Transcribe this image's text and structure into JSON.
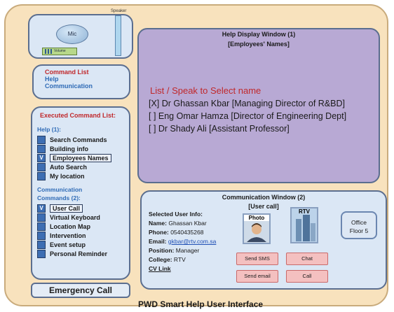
{
  "speaker_label": "Speaker",
  "mic_label": "Mic",
  "volume_label": "Volume",
  "command_panel": {
    "title": "Command List",
    "items": [
      "Help",
      "Communication"
    ]
  },
  "executed": {
    "title": "Executed Command List:",
    "help_header": "Help (1):",
    "help_items": [
      {
        "label": "Search Commands",
        "mark": ""
      },
      {
        "label": "Building info",
        "mark": ""
      },
      {
        "label": "Employees Names",
        "mark": "V"
      },
      {
        "label": "Auto Search",
        "mark": ""
      },
      {
        "label": "My location",
        "mark": ""
      }
    ],
    "comm_header_1": "Communication",
    "comm_header_2": "Commands (2):",
    "comm_items": [
      {
        "label": "User Call",
        "mark": "V"
      },
      {
        "label": "Virtual Keyboard",
        "mark": ""
      },
      {
        "label": "Location Map",
        "mark": ""
      },
      {
        "label": "Intervention",
        "mark": ""
      },
      {
        "label": "Event setup",
        "mark": ""
      },
      {
        "label": "Personal Reminder",
        "mark": ""
      }
    ]
  },
  "emergency_label": "Emergency Call",
  "help_window": {
    "title": "Help Display Window (1)",
    "subtitle": "[Employees' Names]",
    "prompt": "List / Speak to Select name",
    "names": [
      "[X] Dr Ghassan Kbar [Managing Director of R&BD]",
      "[ ] Eng Omar Hamza [Director of Engineering Dept]",
      "[ ] Dr Shady Ali [Assistant Professor]"
    ]
  },
  "comm_window": {
    "title": "Communication Window (2)",
    "subtitle": "[User call]",
    "info_header": "Selected User Info:",
    "name_label": "Name:",
    "name_value": "Ghassan Kbar",
    "phone_label": "Phone:",
    "phone_value": "0540435268",
    "email_label": "Email:",
    "email_value": "gkbar@rtv.com.sa",
    "position_label": "Position:",
    "position_value": "Manager",
    "college_label": "College:",
    "college_value": "RTV",
    "cv_link": "CV Link",
    "photo_label": "Photo",
    "rtv_label": "RTV",
    "office_line1": "Office",
    "office_line2": "Floor 5",
    "buttons": {
      "send_sms": "Send SMS",
      "chat": "Chat",
      "send_email": "Send email",
      "call": "Call"
    }
  },
  "footer_title": "PWD Smart Help User Interface",
  "colors": {
    "background": "#f8e2bd",
    "panel_fill": "#dbe7f5",
    "window_fill": "#b8a9d4",
    "accent_red": "#c0282b",
    "accent_blue": "#2f6bb6",
    "button_fill": "#f4c0c0"
  }
}
